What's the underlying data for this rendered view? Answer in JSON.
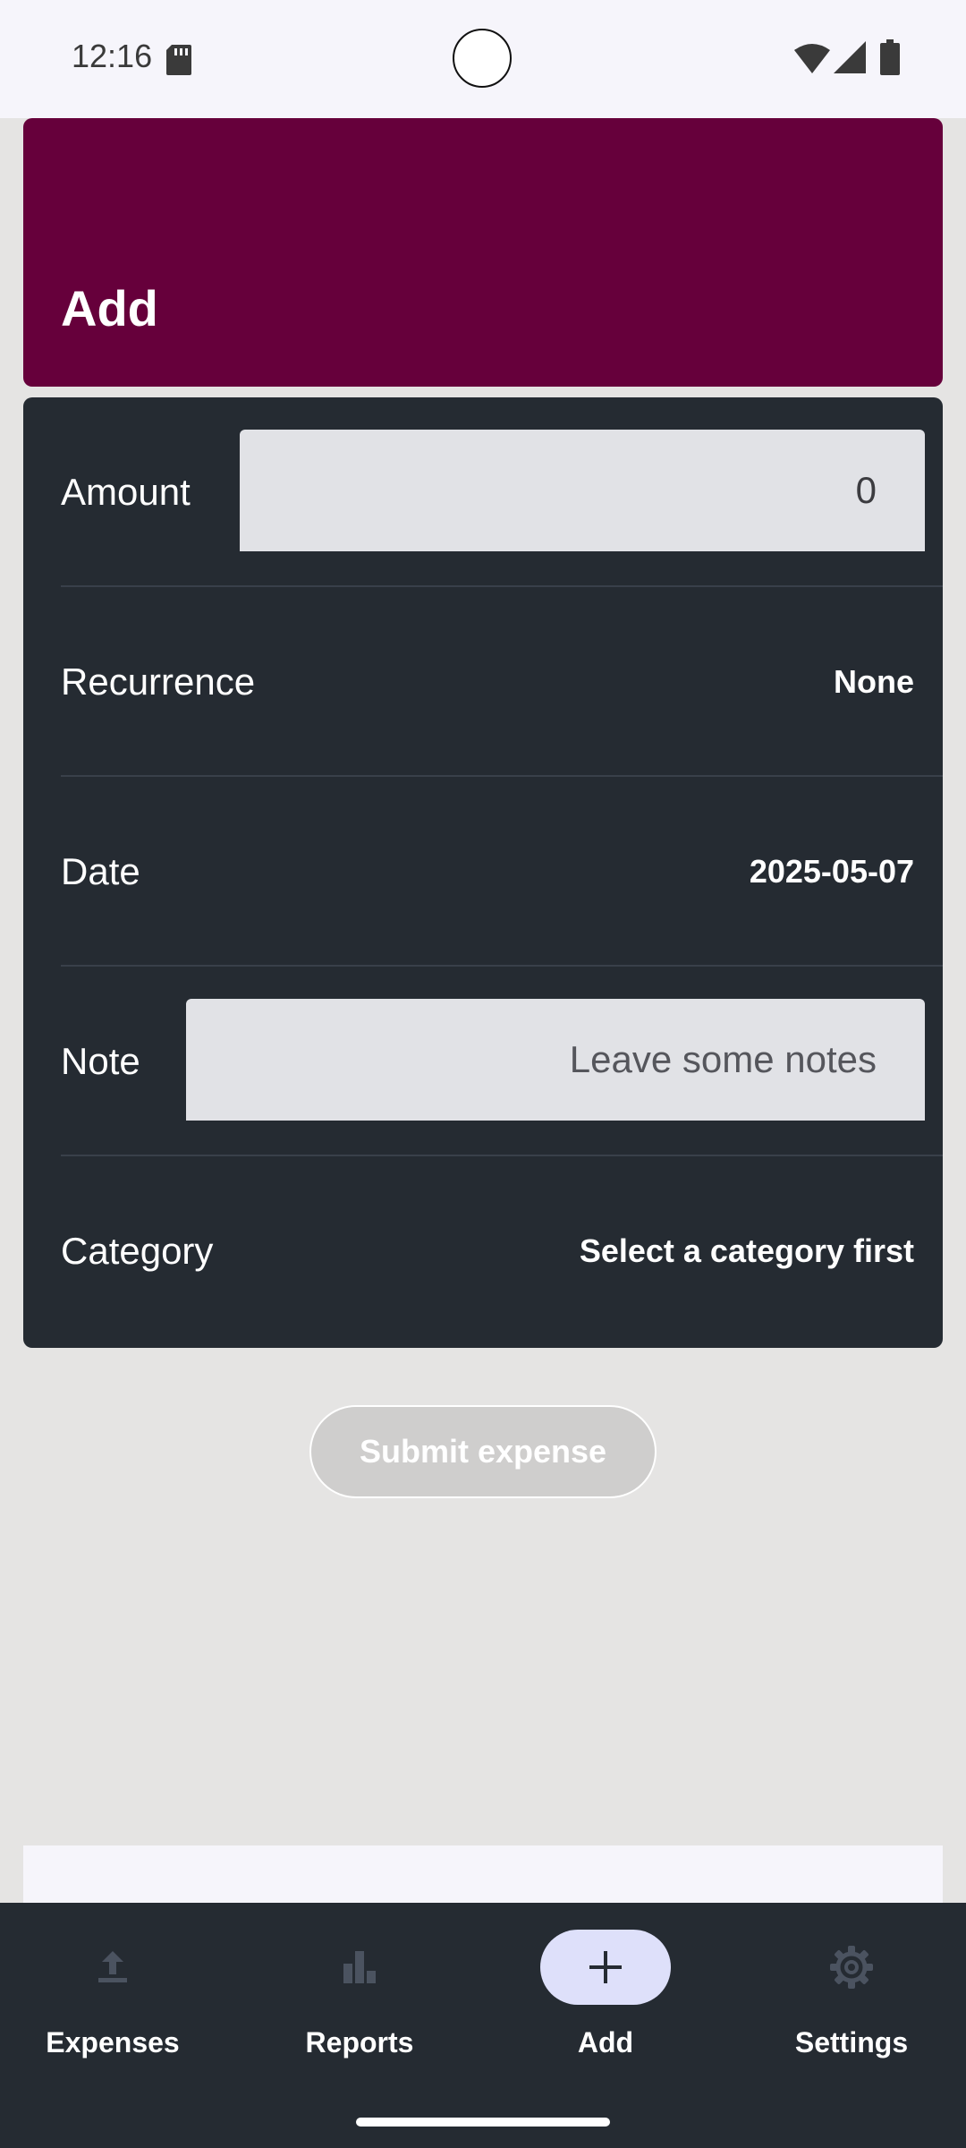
{
  "status_bar": {
    "time": "12:16"
  },
  "header": {
    "title": "Add"
  },
  "form": {
    "amount": {
      "label": "Amount",
      "value": "0"
    },
    "recurrence": {
      "label": "Recurrence",
      "value": "None"
    },
    "date": {
      "label": "Date",
      "value": "2025-05-07"
    },
    "note": {
      "label": "Note",
      "value": "",
      "placeholder": "Leave some notes"
    },
    "category": {
      "label": "Category",
      "value": "Select a category first"
    }
  },
  "submit_label": "Submit expense",
  "nav": {
    "items": [
      {
        "label": "Expenses",
        "icon": "upload-icon",
        "active": false
      },
      {
        "label": "Reports",
        "icon": "bar-chart-icon",
        "active": false
      },
      {
        "label": "Add",
        "icon": "plus-icon",
        "active": true
      },
      {
        "label": "Settings",
        "icon": "gear-icon",
        "active": false
      }
    ]
  },
  "colors": {
    "header_bg": "#66003b",
    "card_bg": "#252b32",
    "page_bg": "#e5e4e3",
    "active_nav_pill": "#dee0fa",
    "input_bg": "#e1e2e6"
  }
}
